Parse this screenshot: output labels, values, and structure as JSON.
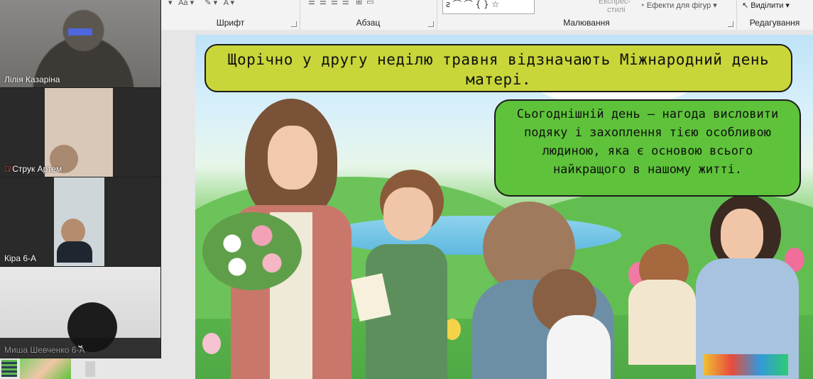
{
  "ribbon": {
    "groups": [
      {
        "label": "Шрифт"
      },
      {
        "label": "Абзац"
      },
      {
        "label": "Малювання"
      },
      {
        "label": "Редагування"
      }
    ],
    "effects_label": "Ефекти для фігур",
    "styles_label": "стилі",
    "express_label": "Експрес-",
    "select_label": "Виділити"
  },
  "participants": [
    {
      "name": "Лілія Казаріна",
      "muted": false,
      "active": true
    },
    {
      "name": "Струк Артем",
      "muted": true,
      "active": false
    },
    {
      "name": "Кіра 6-А",
      "muted": false,
      "active": false
    },
    {
      "name": "Миша Шевченко 6-А",
      "muted": false,
      "active": false
    }
  ],
  "slide": {
    "title": "Щорічно у другу неділю травня відзначають Міжнародний день матері.",
    "info": "Сьогоднішній день — нагода висловити подяку і захоплення тією особливою людиною, яка є основою всього найкращого в нашому житті."
  },
  "colors": {
    "title_bg": "#c8d63a",
    "info_bg": "#5ec33a",
    "active_outline": "#2ecc71"
  },
  "icons": {
    "collapse": "chevron-down-icon",
    "muted": "mic-muted-icon",
    "select": "cursor-icon"
  }
}
